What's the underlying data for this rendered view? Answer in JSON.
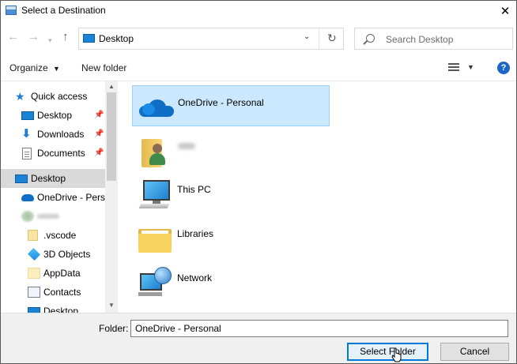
{
  "window": {
    "title": "Select a Destination"
  },
  "nav": {
    "address": "Desktop",
    "search_placeholder": "Search Desktop"
  },
  "toolbar": {
    "organize": "Organize",
    "new_folder": "New folder",
    "help": "?"
  },
  "sidebar": {
    "items": [
      {
        "label": "Quick access",
        "icon": "star-icon",
        "pinned": false
      },
      {
        "label": "Desktop",
        "icon": "desktop-icon",
        "pinned": true
      },
      {
        "label": "Downloads",
        "icon": "download-icon",
        "pinned": true
      },
      {
        "label": "Documents",
        "icon": "documents-icon",
        "pinned": true
      },
      {
        "label": "Desktop",
        "icon": "desktop-icon",
        "selected": true
      },
      {
        "label": "OneDrive - Persc",
        "icon": "onedrive-icon"
      },
      {
        "label": "",
        "icon": "user-icon",
        "blurred": true
      },
      {
        "label": ".vscode",
        "icon": "folder-icon"
      },
      {
        "label": "3D Objects",
        "icon": "3d-objects-icon"
      },
      {
        "label": "AppData",
        "icon": "folder-icon"
      },
      {
        "label": "Contacts",
        "icon": "contacts-icon"
      },
      {
        "label": "Desktop",
        "icon": "desktop-icon"
      }
    ]
  },
  "main": {
    "entries": [
      {
        "label": "OneDrive - Personal",
        "icon": "onedrive-icon",
        "selected": true
      },
      {
        "label": "",
        "icon": "user-folder-icon",
        "blurred": true
      },
      {
        "label": "This PC",
        "icon": "this-pc-icon"
      },
      {
        "label": "Libraries",
        "icon": "libraries-icon"
      },
      {
        "label": "Network",
        "icon": "network-icon"
      }
    ]
  },
  "footer": {
    "folder_label": "Folder:",
    "folder_value": "OneDrive - Personal",
    "select_button": "Select Folder",
    "cancel_button": "Cancel"
  },
  "colors": {
    "selection": "#cce8ff",
    "selection_border": "#99d1ff",
    "accent": "#0078d7",
    "footer_bg": "#f0f0f0"
  }
}
